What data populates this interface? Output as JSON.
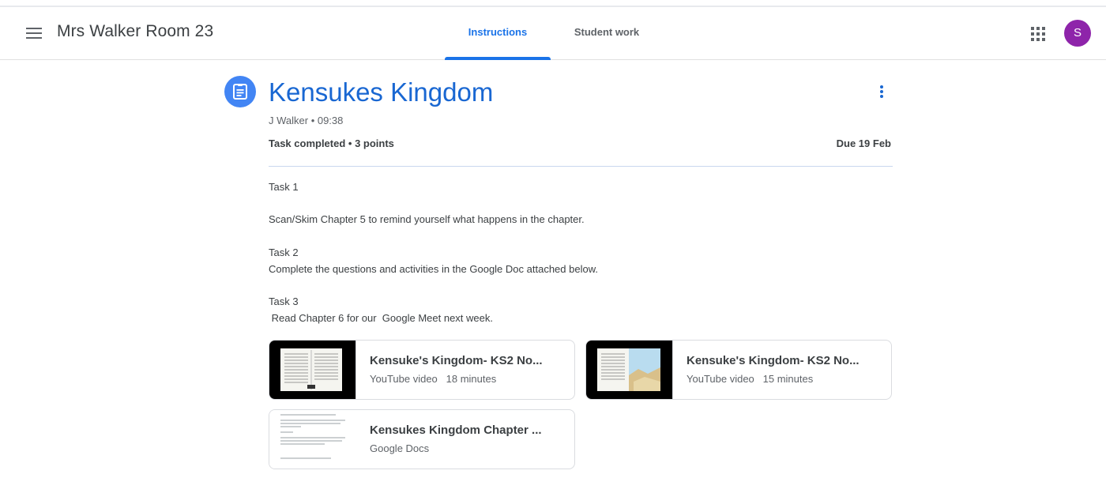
{
  "header": {
    "class_title": "Mrs Walker Room 23",
    "tabs": [
      {
        "label": "Instructions",
        "active": true
      },
      {
        "label": "Student work",
        "active": false
      }
    ],
    "avatar_letter": "S",
    "avatar_color": "#8e24aa",
    "accent_color": "#1a73e8"
  },
  "assignment": {
    "title": "Kensukes Kingdom",
    "meta": "J Walker • 09:38",
    "status": "Task completed • 3 points",
    "due": "Due 19 Feb",
    "instructions": [
      "Task 1",
      "Scan/Skim Chapter 5 to remind yourself what happens in the chapter.",
      "Task 2",
      "Complete the questions and activities in the Google Doc attached below.",
      "Task 3",
      " Read Chapter 6 for our  Google Meet next week."
    ]
  },
  "attachments": [
    {
      "title": "Kensuke's Kingdom- KS2 No...",
      "type": "YouTube video",
      "duration": "18 minutes"
    },
    {
      "title": "Kensuke's Kingdom- KS2 No...",
      "type": "YouTube video",
      "duration": "15 minutes"
    },
    {
      "title": "Kensukes Kingdom Chapter ...",
      "type": "Google Docs",
      "duration": ""
    }
  ],
  "icons": {
    "menu": "hamburger-menu-icon",
    "apps": "google-apps-grid-icon",
    "assignment": "assignment-clipboard-icon",
    "more": "more-vertical-icon"
  }
}
